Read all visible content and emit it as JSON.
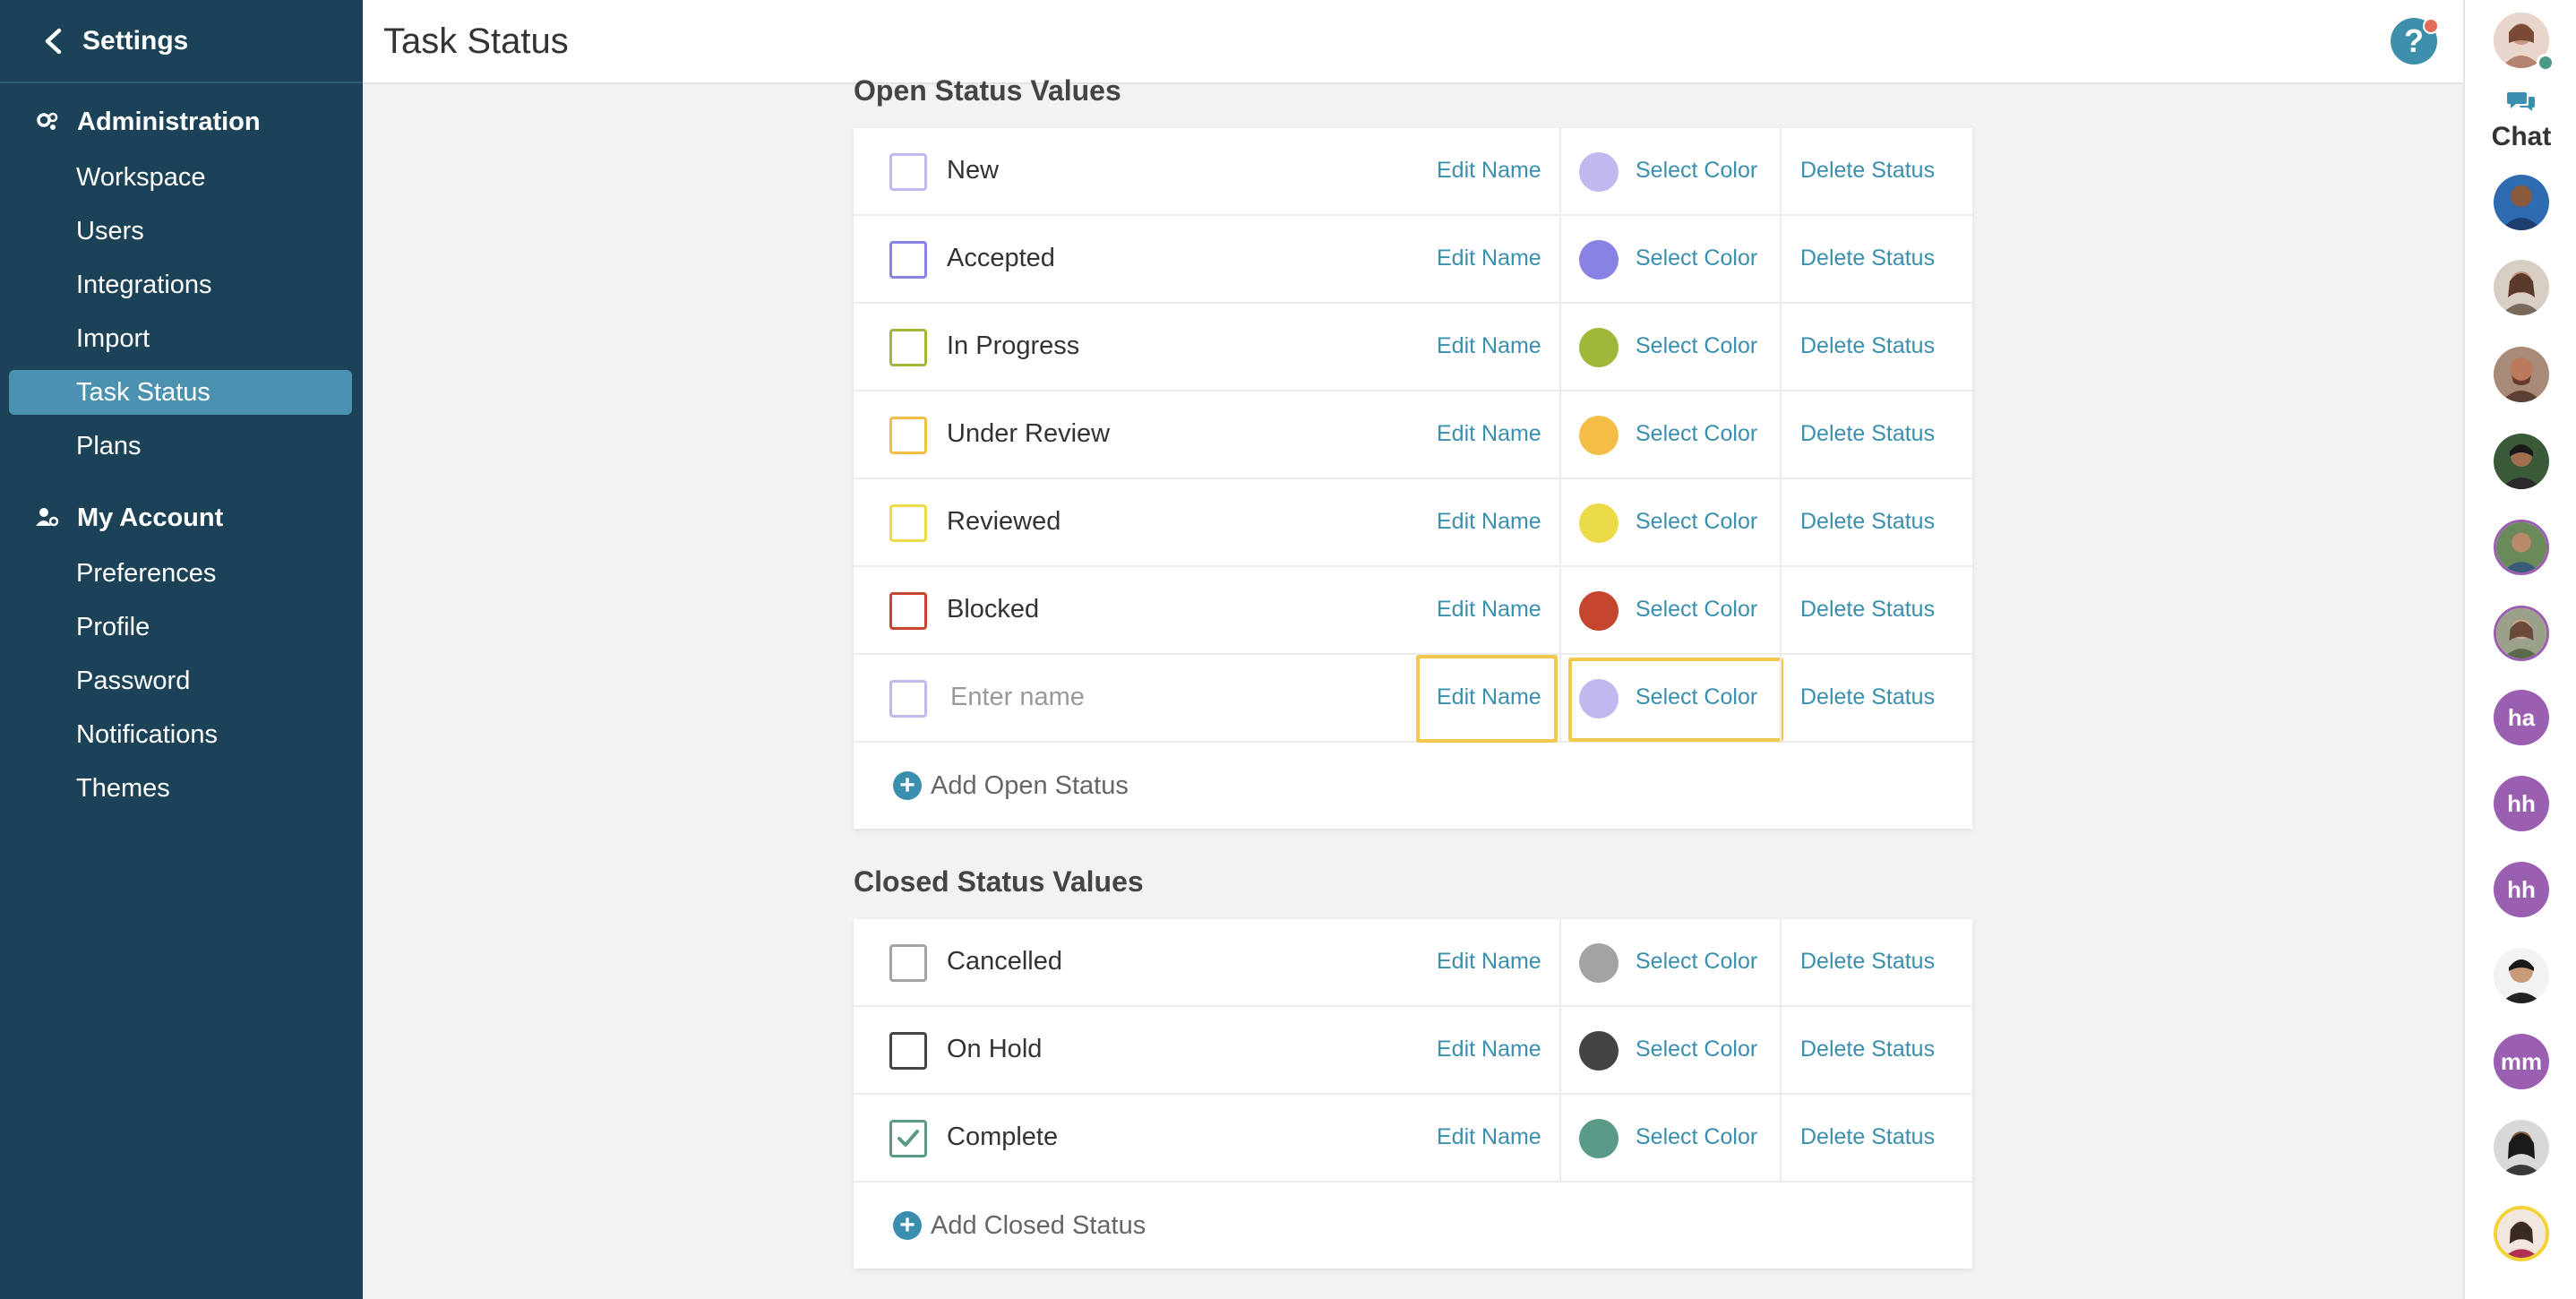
{
  "sidebar": {
    "header": "Settings",
    "sections": [
      {
        "title": "Administration",
        "items": [
          "Workspace",
          "Users",
          "Integrations",
          "Import",
          "Task Status",
          "Plans"
        ]
      },
      {
        "title": "My Account",
        "items": [
          "Preferences",
          "Profile",
          "Password",
          "Notifications",
          "Themes"
        ]
      }
    ],
    "active_item": "Task Status"
  },
  "topbar": {
    "title": "Task Status",
    "help_glyph": "?"
  },
  "chat": {
    "label": "Chat",
    "initials": [
      "ha",
      "hh",
      "hh",
      "mm"
    ]
  },
  "actions": {
    "edit": "Edit Name",
    "color": "Select Color",
    "delete": "Delete Status"
  },
  "open": {
    "title": "Open Status Values",
    "add_label": "Add Open Status",
    "placeholder": "Enter name",
    "rows": [
      {
        "name": "New",
        "color": "#c3b7ef",
        "checked": false
      },
      {
        "name": "Accepted",
        "color": "#8882e4",
        "checked": false
      },
      {
        "name": "In Progress",
        "color": "#a0b83a",
        "checked": false
      },
      {
        "name": "Under Review",
        "color": "#f4be46",
        "checked": false
      },
      {
        "name": "Reviewed",
        "color": "#ecdb48",
        "checked": false
      },
      {
        "name": "Blocked",
        "color": "#c5452f",
        "checked": false
      },
      {
        "name": "",
        "color": "#c3b7ef",
        "checked": false
      }
    ]
  },
  "closed": {
    "title": "Closed Status Values",
    "add_label": "Add Closed Status",
    "rows": [
      {
        "name": "Cancelled",
        "color": "#a3a3a3",
        "checked": false
      },
      {
        "name": "On Hold",
        "color": "#444444",
        "checked": false
      },
      {
        "name": "Complete",
        "color": "#5a9a88",
        "checked": true
      }
    ]
  }
}
